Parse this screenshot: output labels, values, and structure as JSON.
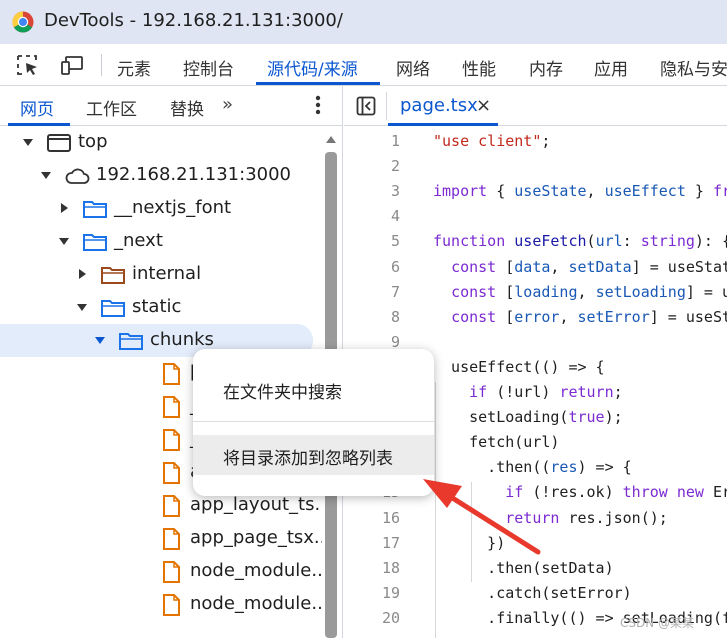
{
  "window": {
    "title": "DevTools - 192.168.21.131:3000/"
  },
  "main_tabs": [
    {
      "label": "元素",
      "active": false
    },
    {
      "label": "控制台",
      "active": false
    },
    {
      "label": "源代码/来源",
      "active": true
    },
    {
      "label": "网络",
      "active": false
    },
    {
      "label": "性能",
      "active": false
    },
    {
      "label": "内存",
      "active": false
    },
    {
      "label": "应用",
      "active": false
    },
    {
      "label": "隐私与安",
      "active": false
    }
  ],
  "navigator": {
    "tabs": [
      {
        "label": "网页",
        "active": true
      },
      {
        "label": "工作区",
        "active": false
      },
      {
        "label": "替换",
        "active": false
      }
    ],
    "more_label": "»",
    "tree": [
      {
        "label": "top",
        "icon": "frame-icon",
        "expanded": true
      },
      {
        "label": "192.168.21.131:3000",
        "icon": "cloud-icon",
        "expanded": true
      },
      {
        "label": "__nextjs_font",
        "icon": "folder-icon",
        "expanded": false
      },
      {
        "label": "_next",
        "icon": "folder-icon",
        "expanded": true
      },
      {
        "label": "internal",
        "icon": "folder-icon",
        "expanded": false
      },
      {
        "label": "static",
        "icon": "folder-icon",
        "expanded": true
      },
      {
        "label": "chunks",
        "icon": "folder-icon",
        "expanded": true,
        "selected": true
      },
      {
        "label": "[tu",
        "icon": "file-icon"
      },
      {
        "label": "_a",
        "icon": "file-icon"
      },
      {
        "label": "_a",
        "icon": "file-icon"
      },
      {
        "label": "app",
        "icon": "file-icon"
      },
      {
        "label": "app_layout_ts...",
        "icon": "file-icon"
      },
      {
        "label": "app_page_tsx...",
        "icon": "file-icon"
      },
      {
        "label": "node_module...",
        "icon": "file-icon"
      },
      {
        "label": "node_module...",
        "icon": "file-icon"
      }
    ]
  },
  "editor": {
    "file_tab": {
      "label": "page.tsx",
      "close": "×"
    },
    "lines": [
      {
        "n": "1",
        "parts": [
          [
            "str",
            "\"use client\""
          ],
          [
            "p",
            ";"
          ]
        ]
      },
      {
        "n": "2",
        "parts": []
      },
      {
        "n": "3",
        "parts": [
          [
            "kw",
            "import"
          ],
          [
            "p",
            " { "
          ],
          [
            "var",
            "useState"
          ],
          [
            "p",
            ", "
          ],
          [
            "var",
            "useEffect"
          ],
          [
            "p",
            " } "
          ],
          [
            "kw",
            "fr"
          ]
        ]
      },
      {
        "n": "4",
        "parts": []
      },
      {
        "n": "5",
        "parts": [
          [
            "kw",
            "function"
          ],
          [
            "p",
            " "
          ],
          [
            "fn",
            "useFetch"
          ],
          [
            "p",
            "("
          ],
          [
            "var",
            "url"
          ],
          [
            "p",
            ": "
          ],
          [
            "kw",
            "string"
          ],
          [
            "p",
            "): {"
          ]
        ]
      },
      {
        "n": "6",
        "parts": [
          [
            "p",
            "  "
          ],
          [
            "kw",
            "const"
          ],
          [
            "p",
            " ["
          ],
          [
            "var",
            "data"
          ],
          [
            "p",
            ", "
          ],
          [
            "var",
            "setData"
          ],
          [
            "p",
            "] = useStat"
          ]
        ]
      },
      {
        "n": "7",
        "parts": [
          [
            "p",
            "  "
          ],
          [
            "kw",
            "const"
          ],
          [
            "p",
            " ["
          ],
          [
            "var",
            "loading"
          ],
          [
            "p",
            ", "
          ],
          [
            "var",
            "setLoading"
          ],
          [
            "p",
            "] = u"
          ]
        ]
      },
      {
        "n": "8",
        "parts": [
          [
            "p",
            "  "
          ],
          [
            "kw",
            "const"
          ],
          [
            "p",
            " ["
          ],
          [
            "var",
            "error"
          ],
          [
            "p",
            ", "
          ],
          [
            "var",
            "setError"
          ],
          [
            "p",
            "] = useSt"
          ]
        ]
      },
      {
        "n": "9",
        "parts": []
      },
      {
        "n": "10",
        "parts": [
          [
            "p",
            "  useEffect(() => {"
          ]
        ]
      },
      {
        "n": "11",
        "parts": [
          [
            "p",
            "    "
          ],
          [
            "kw",
            "if"
          ],
          [
            "p",
            " (!url) "
          ],
          [
            "kw",
            "return"
          ],
          [
            "p",
            ";"
          ]
        ]
      },
      {
        "n": "12",
        "parts": [
          [
            "p",
            "    setLoading("
          ],
          [
            "kw",
            "true"
          ],
          [
            "p",
            ");"
          ]
        ]
      },
      {
        "n": "13",
        "parts": [
          [
            "p",
            "    fetch(url)"
          ]
        ]
      },
      {
        "n": "14",
        "parts": [
          [
            "p",
            "      .then(("
          ],
          [
            "var",
            "res"
          ],
          [
            "p",
            ") => {"
          ]
        ]
      },
      {
        "n": "15",
        "parts": [
          [
            "p",
            "        "
          ],
          [
            "kw",
            "if"
          ],
          [
            "p",
            " (!res.ok) "
          ],
          [
            "kw",
            "throw"
          ],
          [
            "p",
            " "
          ],
          [
            "kw",
            "new"
          ],
          [
            "p",
            " Er"
          ]
        ]
      },
      {
        "n": "16",
        "parts": [
          [
            "p",
            "        "
          ],
          [
            "kw",
            "return"
          ],
          [
            "p",
            " res.json();"
          ]
        ]
      },
      {
        "n": "17",
        "parts": [
          [
            "p",
            "      })"
          ]
        ]
      },
      {
        "n": "18",
        "parts": [
          [
            "p",
            "      .then(setData)"
          ]
        ]
      },
      {
        "n": "19",
        "parts": [
          [
            "p",
            "      .catch(setError)"
          ]
        ]
      },
      {
        "n": "20",
        "parts": [
          [
            "p",
            "      .finally(() => setLoading(f"
          ]
        ]
      }
    ]
  },
  "context_menu": {
    "items": [
      {
        "label": "在文件夹中搜索",
        "hover": false
      },
      {
        "label": "将目录添加到忽略列表",
        "hover": true
      }
    ]
  },
  "watermark": "CSDN @某某",
  "colors": {
    "accent": "#0b57d0",
    "folder": "#1a73e8",
    "file": "#e37400",
    "annotation_arrow": "#e8392c"
  }
}
